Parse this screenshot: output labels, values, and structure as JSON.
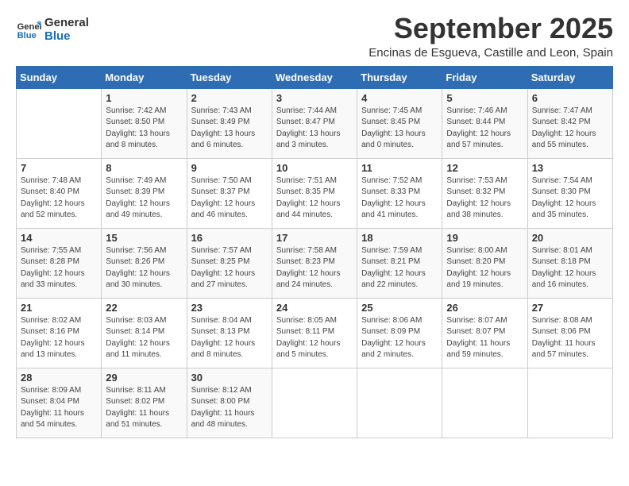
{
  "logo": {
    "line1": "General",
    "line2": "Blue"
  },
  "title": "September 2025",
  "subtitle": "Encinas de Esgueva, Castille and Leon, Spain",
  "weekdays": [
    "Sunday",
    "Monday",
    "Tuesday",
    "Wednesday",
    "Thursday",
    "Friday",
    "Saturday"
  ],
  "weeks": [
    [
      {
        "day": "",
        "info": ""
      },
      {
        "day": "1",
        "info": "Sunrise: 7:42 AM\nSunset: 8:50 PM\nDaylight: 13 hours\nand 8 minutes."
      },
      {
        "day": "2",
        "info": "Sunrise: 7:43 AM\nSunset: 8:49 PM\nDaylight: 13 hours\nand 6 minutes."
      },
      {
        "day": "3",
        "info": "Sunrise: 7:44 AM\nSunset: 8:47 PM\nDaylight: 13 hours\nand 3 minutes."
      },
      {
        "day": "4",
        "info": "Sunrise: 7:45 AM\nSunset: 8:45 PM\nDaylight: 13 hours\nand 0 minutes."
      },
      {
        "day": "5",
        "info": "Sunrise: 7:46 AM\nSunset: 8:44 PM\nDaylight: 12 hours\nand 57 minutes."
      },
      {
        "day": "6",
        "info": "Sunrise: 7:47 AM\nSunset: 8:42 PM\nDaylight: 12 hours\nand 55 minutes."
      }
    ],
    [
      {
        "day": "7",
        "info": "Sunrise: 7:48 AM\nSunset: 8:40 PM\nDaylight: 12 hours\nand 52 minutes."
      },
      {
        "day": "8",
        "info": "Sunrise: 7:49 AM\nSunset: 8:39 PM\nDaylight: 12 hours\nand 49 minutes."
      },
      {
        "day": "9",
        "info": "Sunrise: 7:50 AM\nSunset: 8:37 PM\nDaylight: 12 hours\nand 46 minutes."
      },
      {
        "day": "10",
        "info": "Sunrise: 7:51 AM\nSunset: 8:35 PM\nDaylight: 12 hours\nand 44 minutes."
      },
      {
        "day": "11",
        "info": "Sunrise: 7:52 AM\nSunset: 8:33 PM\nDaylight: 12 hours\nand 41 minutes."
      },
      {
        "day": "12",
        "info": "Sunrise: 7:53 AM\nSunset: 8:32 PM\nDaylight: 12 hours\nand 38 minutes."
      },
      {
        "day": "13",
        "info": "Sunrise: 7:54 AM\nSunset: 8:30 PM\nDaylight: 12 hours\nand 35 minutes."
      }
    ],
    [
      {
        "day": "14",
        "info": "Sunrise: 7:55 AM\nSunset: 8:28 PM\nDaylight: 12 hours\nand 33 minutes."
      },
      {
        "day": "15",
        "info": "Sunrise: 7:56 AM\nSunset: 8:26 PM\nDaylight: 12 hours\nand 30 minutes."
      },
      {
        "day": "16",
        "info": "Sunrise: 7:57 AM\nSunset: 8:25 PM\nDaylight: 12 hours\nand 27 minutes."
      },
      {
        "day": "17",
        "info": "Sunrise: 7:58 AM\nSunset: 8:23 PM\nDaylight: 12 hours\nand 24 minutes."
      },
      {
        "day": "18",
        "info": "Sunrise: 7:59 AM\nSunset: 8:21 PM\nDaylight: 12 hours\nand 22 minutes."
      },
      {
        "day": "19",
        "info": "Sunrise: 8:00 AM\nSunset: 8:20 PM\nDaylight: 12 hours\nand 19 minutes."
      },
      {
        "day": "20",
        "info": "Sunrise: 8:01 AM\nSunset: 8:18 PM\nDaylight: 12 hours\nand 16 minutes."
      }
    ],
    [
      {
        "day": "21",
        "info": "Sunrise: 8:02 AM\nSunset: 8:16 PM\nDaylight: 12 hours\nand 13 minutes."
      },
      {
        "day": "22",
        "info": "Sunrise: 8:03 AM\nSunset: 8:14 PM\nDaylight: 12 hours\nand 11 minutes."
      },
      {
        "day": "23",
        "info": "Sunrise: 8:04 AM\nSunset: 8:13 PM\nDaylight: 12 hours\nand 8 minutes."
      },
      {
        "day": "24",
        "info": "Sunrise: 8:05 AM\nSunset: 8:11 PM\nDaylight: 12 hours\nand 5 minutes."
      },
      {
        "day": "25",
        "info": "Sunrise: 8:06 AM\nSunset: 8:09 PM\nDaylight: 12 hours\nand 2 minutes."
      },
      {
        "day": "26",
        "info": "Sunrise: 8:07 AM\nSunset: 8:07 PM\nDaylight: 11 hours\nand 59 minutes."
      },
      {
        "day": "27",
        "info": "Sunrise: 8:08 AM\nSunset: 8:06 PM\nDaylight: 11 hours\nand 57 minutes."
      }
    ],
    [
      {
        "day": "28",
        "info": "Sunrise: 8:09 AM\nSunset: 8:04 PM\nDaylight: 11 hours\nand 54 minutes."
      },
      {
        "day": "29",
        "info": "Sunrise: 8:11 AM\nSunset: 8:02 PM\nDaylight: 11 hours\nand 51 minutes."
      },
      {
        "day": "30",
        "info": "Sunrise: 8:12 AM\nSunset: 8:00 PM\nDaylight: 11 hours\nand 48 minutes."
      },
      {
        "day": "",
        "info": ""
      },
      {
        "day": "",
        "info": ""
      },
      {
        "day": "",
        "info": ""
      },
      {
        "day": "",
        "info": ""
      }
    ]
  ]
}
